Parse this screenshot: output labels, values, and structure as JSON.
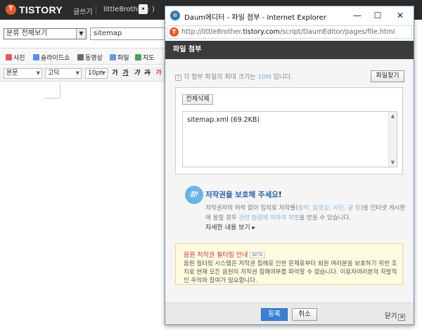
{
  "tistory": {
    "logo_letter": "T",
    "logo_text": "TISTORY",
    "write_label": "글쓰기",
    "user_label": "little8rother : )",
    "user_dropdown": "▾",
    "category_select": "분류 전체보기",
    "title_value": "sitemap"
  },
  "toolbar1": {
    "items": [
      {
        "label": "사진",
        "icon": "photo-icon",
        "color": "#e35b5b"
      },
      {
        "label": "슬라이드쇼",
        "icon": "slideshow-icon",
        "color": "#5b8de3"
      },
      {
        "label": "동영상",
        "icon": "video-icon",
        "color": "#6a6a6a"
      },
      {
        "label": "파일",
        "icon": "file-icon",
        "color": "#6a9be0"
      },
      {
        "label": "지도",
        "icon": "map-icon",
        "color": "#4aa35d"
      }
    ]
  },
  "toolbar2": {
    "paragraph": "본문",
    "font": "고딕",
    "size": "10pt",
    "buttons": [
      "가",
      "가",
      "가",
      "가",
      "가"
    ]
  },
  "ie": {
    "title": "Daum에디터 - 파일 첨부 - Internet Explorer",
    "url_prefix": "http://little8rother.",
    "url_domain": "tistory.com",
    "url_path": "/script/DaumEditor/pages/file.html",
    "minimize": "—",
    "maximize": "☐",
    "close": "✕"
  },
  "popup": {
    "header": "파일 첨부",
    "info_prefix": "각 첨부 파일의 최대 크기는",
    "info_size": "10M",
    "info_suffix": "입니다.",
    "find_button": "파일찾기",
    "delete_all_button": "전체삭제",
    "files": [
      "sitemap.xml (69.2KB)"
    ],
    "copyright_title": "저작권을 보호해 주세요",
    "copyright_text_1": "저작권자의 허락 없이 임의로 저작물(",
    "copyright_text_hl1": "음악, 동영상, 사진, 글 등",
    "copyright_text_2": ")을 인터넷 게시판에 올릴 경우",
    "copyright_text_hl2": "관련 법령에 의하여 처벌",
    "copyright_text_3": "을 받을 수 있습니다.",
    "more_link": "자세한 내용 보기 ▸",
    "notice_title": "음원 저작권 필터링 안내",
    "beta_badge": "BETA",
    "notice_text": "음원 필터링 시스템은 저작권 침해로 인한 문제로부터 회원 여러분을 보호하기 위한 조치로 현재 모든 음원의 저작권 침해여부를 파악할 수 없습니다. 이용자여러분의 자발적인 주의와 참여가 필요합니다.",
    "ok_button": "등록",
    "cancel_button": "취소",
    "close_link": "닫기"
  }
}
